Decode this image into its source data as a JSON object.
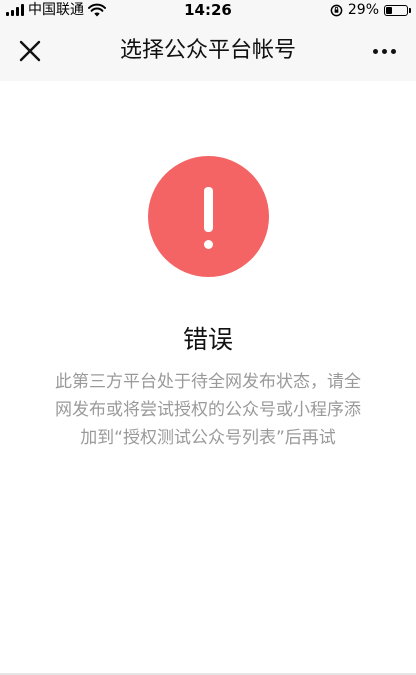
{
  "status_bar": {
    "carrier": "中国联通",
    "time": "14:26",
    "battery_text": "29%",
    "battery_level": 0.29
  },
  "nav": {
    "title": "选择公众平台帐号"
  },
  "error": {
    "title": "错误",
    "message": "此第三方平台处于待全网发布状态，请全网发布或将尝试授权的公众号或小程序添加到“授权测试公众号列表”后再试"
  },
  "colors": {
    "error_accent": "#f56464",
    "nav_background": "#f7f7f7",
    "message_text": "#9a9a9a"
  },
  "icons": {
    "close": "close-icon",
    "more": "more-icon",
    "alert": "exclamation-icon"
  }
}
